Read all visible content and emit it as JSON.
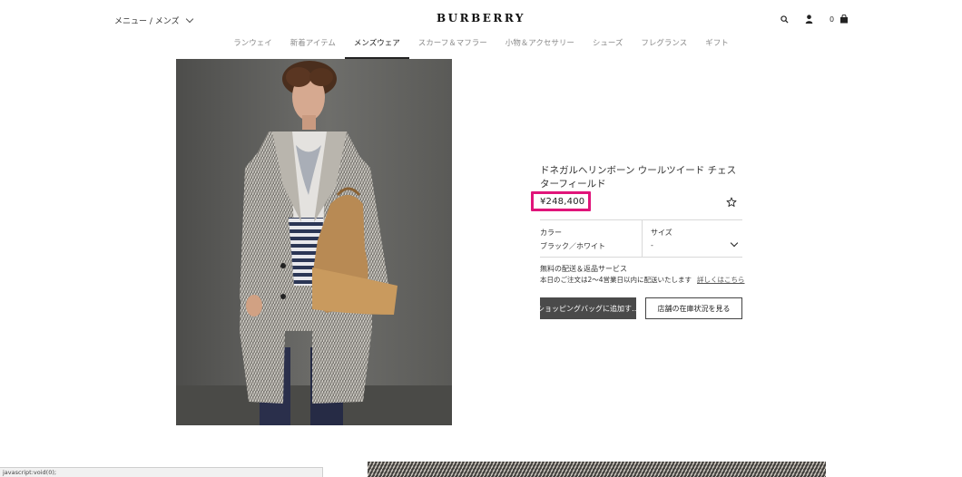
{
  "header": {
    "menu_label": "メニュー / メンズ",
    "brand": "BURBERRY",
    "bag_count": "0"
  },
  "nav": {
    "items": [
      {
        "label": "ランウェイ"
      },
      {
        "label": "新着アイテム"
      },
      {
        "label": "メンズウェア"
      },
      {
        "label": "スカーフ＆マフラー"
      },
      {
        "label": "小物＆アクセサリー"
      },
      {
        "label": "シューズ"
      },
      {
        "label": "フレグランス"
      },
      {
        "label": "ギフト"
      }
    ],
    "active": "メンズウェア"
  },
  "product": {
    "title": "ドネガルヘリンボーン ウールツイード チェスターフィールド",
    "price": "¥248,400",
    "price_highlight_color": "#e0157a",
    "color_label": "カラー",
    "color_value": "ブラック／ホワイト",
    "size_label": "サイズ",
    "size_value": "-",
    "shipping_title": "無料の配送＆返品サービス",
    "shipping_note": "本日のご注文は2～4営業日以内に配送いたします",
    "shipping_link": "詳しくはこちら",
    "add_to_bag": "ショッピングバッグに追加す…",
    "store_stock": "店舗の在庫状況を見る"
  },
  "status_bar": {
    "text": "javascript:void(0);"
  },
  "colors": {
    "primary_button": "#4a4a4a",
    "accent": "#e0157a"
  }
}
